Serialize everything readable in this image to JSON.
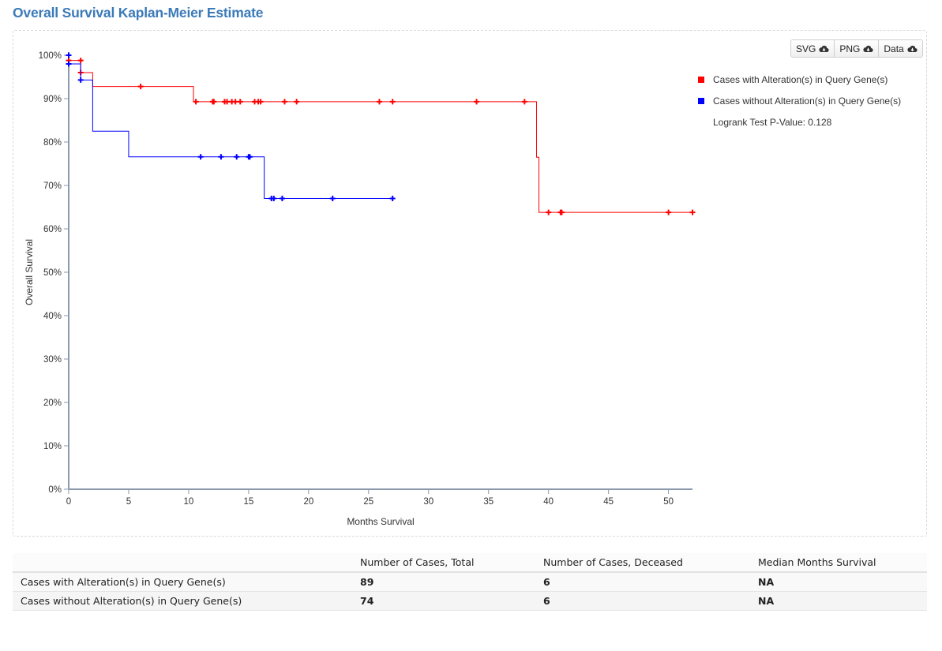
{
  "page": {
    "title": "Overall Survival Kaplan-Meier Estimate"
  },
  "toolbar": {
    "svg_label": "SVG",
    "png_label": "PNG",
    "data_label": "Data"
  },
  "legend": {
    "altered_label": "Cases with Alteration(s) in Query Gene(s)",
    "unaltered_label": "Cases without Alteration(s) in Query Gene(s)",
    "pvalue_text": "Logrank Test P-Value: 0.128"
  },
  "chart_data": {
    "type": "line",
    "step": "post",
    "title": "",
    "xlabel": "Months Survival",
    "ylabel": "Overall Survival",
    "xlim": [
      0,
      52
    ],
    "ylim": [
      0,
      100
    ],
    "x_ticks": [
      0,
      5,
      10,
      15,
      20,
      25,
      30,
      35,
      40,
      45,
      50
    ],
    "y_ticks": [
      0,
      10,
      20,
      30,
      40,
      50,
      60,
      70,
      80,
      90,
      100
    ],
    "y_tick_format": "{v}%",
    "legend_position": "top-right",
    "grid": false,
    "series": [
      {
        "name": "Cases with Alteration(s) in Query Gene(s)",
        "color": "#ff0000",
        "steps": [
          [
            0,
            98.8
          ],
          [
            1.0,
            96.0
          ],
          [
            2.0,
            92.8
          ],
          [
            10.4,
            89.3
          ],
          [
            39.0,
            76.5
          ],
          [
            39.2,
            63.8
          ],
          [
            52,
            63.8
          ]
        ],
        "censored": [
          [
            0,
            98.8
          ],
          [
            1.0,
            98.8
          ],
          [
            1.0,
            96.0
          ],
          [
            6.0,
            92.8
          ],
          [
            10.6,
            89.3
          ],
          [
            12.0,
            89.3
          ],
          [
            12.1,
            89.3
          ],
          [
            13.0,
            89.3
          ],
          [
            13.2,
            89.3
          ],
          [
            13.6,
            89.3
          ],
          [
            13.9,
            89.3
          ],
          [
            14.3,
            89.3
          ],
          [
            15.5,
            89.3
          ],
          [
            15.8,
            89.3
          ],
          [
            16.0,
            89.3
          ],
          [
            18.0,
            89.3
          ],
          [
            19.0,
            89.3
          ],
          [
            25.9,
            89.3
          ],
          [
            27.0,
            89.3
          ],
          [
            34.0,
            89.3
          ],
          [
            38.0,
            89.3
          ],
          [
            40.0,
            63.8
          ],
          [
            41.0,
            63.8
          ],
          [
            41.1,
            63.8
          ],
          [
            50.0,
            63.8
          ],
          [
            52.0,
            63.8
          ]
        ]
      },
      {
        "name": "Cases without Alteration(s) in Query Gene(s)",
        "color": "#0000ff",
        "steps": [
          [
            0,
            98.0
          ],
          [
            1.0,
            94.3
          ],
          [
            2.0,
            82.5
          ],
          [
            5.0,
            76.6
          ],
          [
            16.3,
            67.0
          ],
          [
            27.0,
            67.0
          ]
        ],
        "censored": [
          [
            0,
            100
          ],
          [
            0,
            98.0
          ],
          [
            1.0,
            94.3
          ],
          [
            11.0,
            76.6
          ],
          [
            12.7,
            76.6
          ],
          [
            14.0,
            76.6
          ],
          [
            15.0,
            76.6
          ],
          [
            15.1,
            76.6
          ],
          [
            16.9,
            67.0
          ],
          [
            17.1,
            67.0
          ],
          [
            17.8,
            67.0
          ],
          [
            22.0,
            67.0
          ],
          [
            27.0,
            67.0
          ]
        ]
      }
    ]
  },
  "table": {
    "headers": [
      "",
      "Number of Cases, Total",
      "Number of Cases, Deceased",
      "Median Months Survival"
    ],
    "rows": [
      {
        "label": "Cases with Alteration(s) in Query Gene(s)",
        "total": "89",
        "deceased": "6",
        "median": "NA"
      },
      {
        "label": "Cases without Alteration(s) in Query Gene(s)",
        "total": "74",
        "deceased": "6",
        "median": "NA"
      }
    ]
  }
}
